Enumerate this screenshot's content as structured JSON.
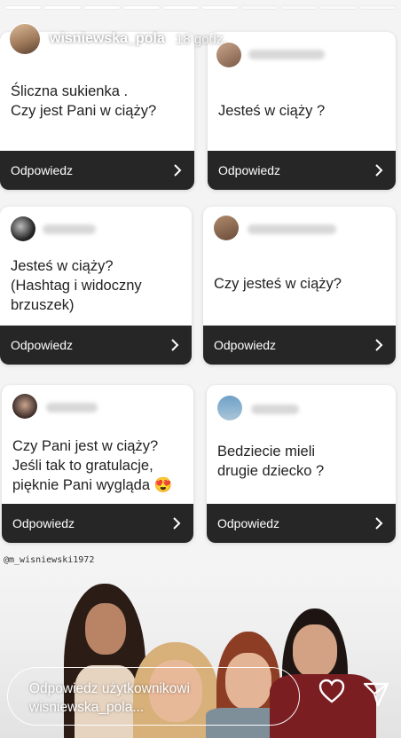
{
  "story": {
    "username": "wisniewska_pola",
    "time": "18 godz.",
    "segments_total": 10,
    "segments_done": 6
  },
  "header_icons": [
    "play-icon",
    "mute-icon",
    "more-icon"
  ],
  "cards": [
    {
      "question": "Śliczna sukienka .\nCzy jest Pani w ciąży?",
      "answer_label": "Odpowiedz"
    },
    {
      "question": "Jesteś w ciąży ?",
      "answer_label": "Odpowiedz"
    },
    {
      "question": "Jesteś w ciąży?\n(Hashtag i widoczny\nbrzuszek)",
      "answer_label": "Odpowiedz"
    },
    {
      "question": "Czy jesteś w ciąży?",
      "answer_label": "Odpowiedz"
    },
    {
      "question": "Czy Pani jest w ciąży?\nJeśli tak to gratulacje,\npięknie Pani wygląda 😍",
      "answer_label": "Odpowiedz"
    },
    {
      "question": "Bedziecie mieli\ndrugie dziecko ?",
      "answer_label": "Odpowiedz"
    }
  ],
  "mention": "@m_wisniewski1972",
  "reply": {
    "placeholder": "Odpowiedz użytkownikowi\nwisniewska_pola..."
  },
  "footer_icons": [
    "heart-icon",
    "send-icon"
  ],
  "colors": {
    "answer_bar": "#262626",
    "card_bg": "#ffffff"
  }
}
